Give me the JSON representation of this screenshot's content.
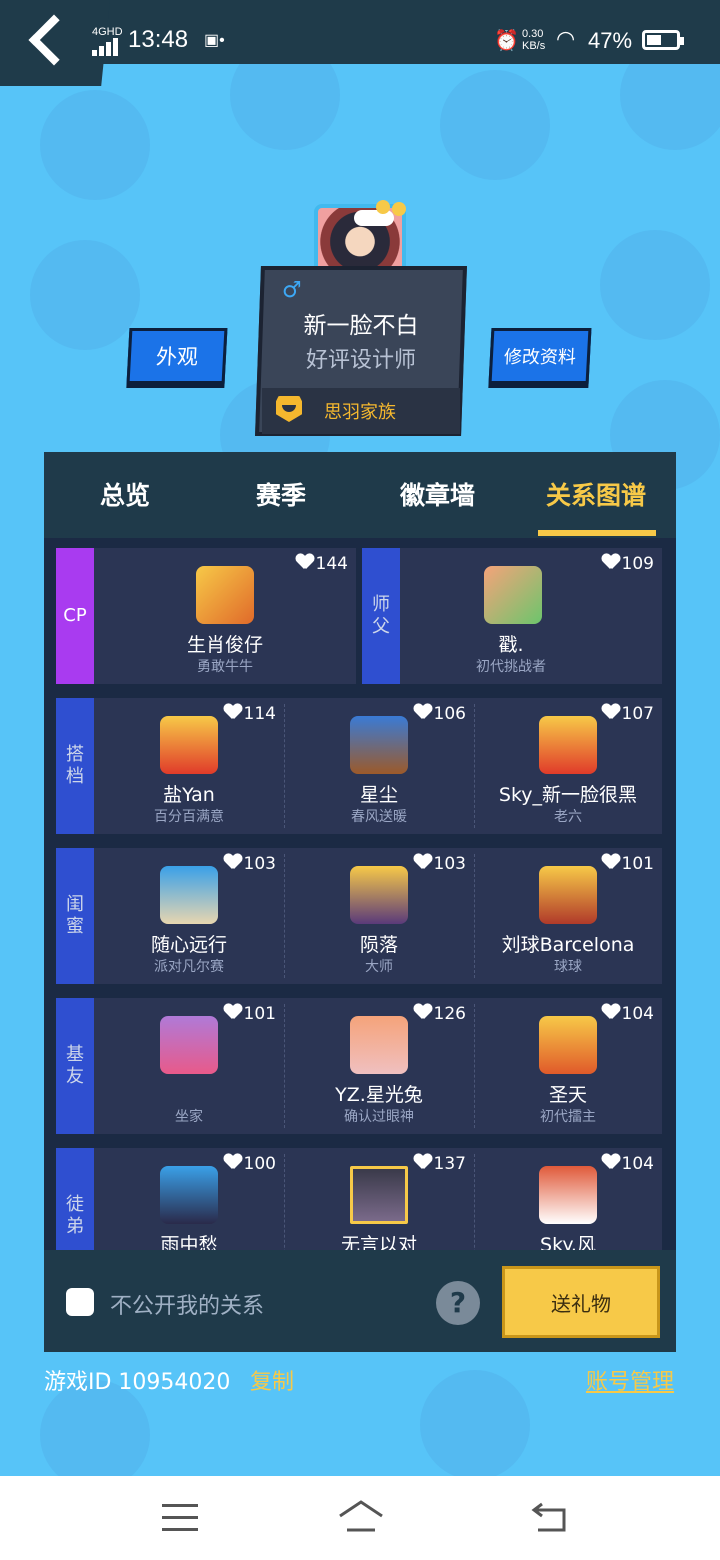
{
  "status_bar": {
    "network": "4GHD",
    "time": "13:48",
    "speed_top": "0.30",
    "speed_bottom": "KB/s",
    "battery": "47%",
    "battery_level": 0.47
  },
  "profile": {
    "nickname": "新一脸不白",
    "title": "好评设计师",
    "family": "思羽家族",
    "gender": "♂"
  },
  "buttons": {
    "appearance": "外观",
    "edit_profile": "修改资料",
    "send_gift": "送礼物"
  },
  "tabs": [
    {
      "label": "总览"
    },
    {
      "label": "赛季"
    },
    {
      "label": "徽章墙"
    },
    {
      "label": "关系图谱"
    }
  ],
  "relations": {
    "cp": {
      "label": "CP",
      "name": "生肖俊仔",
      "sub": "勇敢牛牛",
      "hearts": "144",
      "color": "#a93bf0"
    },
    "master": {
      "label": "师父",
      "name": "戳.",
      "sub": "初代挑战者",
      "hearts": "109",
      "color": "#2f4fd0"
    },
    "rows": [
      {
        "label": "搭档",
        "people": [
          {
            "name": "盐Yan",
            "sub": "百分百满意",
            "hearts": "114"
          },
          {
            "name": "星尘",
            "sub": "春风送暖",
            "hearts": "106"
          },
          {
            "name": "Sky_新一脸很黑",
            "sub": "老六",
            "hearts": "107"
          }
        ]
      },
      {
        "label": "闺蜜",
        "people": [
          {
            "name": "随心远行",
            "sub": "派对凡尔赛",
            "hearts": "103"
          },
          {
            "name": "陨落",
            "sub": "大师",
            "hearts": "103"
          },
          {
            "name": "刘球Barcelona",
            "sub": "球球",
            "hearts": "101"
          }
        ]
      },
      {
        "label": "基友",
        "people": [
          {
            "name": "",
            "sub": "坐家",
            "hearts": "101"
          },
          {
            "name": "YZ.星光兔",
            "sub": "确认过眼神",
            "hearts": "126"
          },
          {
            "name": "圣天",
            "sub": "初代擂主",
            "hearts": "104"
          }
        ]
      },
      {
        "label": "徒弟",
        "people": [
          {
            "name": "雨中愁",
            "sub": "",
            "hearts": "100"
          },
          {
            "name": "无言以对",
            "sub": "",
            "hearts": "137"
          },
          {
            "name": "Sky.风",
            "sub": "",
            "hearts": "104"
          }
        ]
      }
    ]
  },
  "footer": {
    "private_label": "不公开我的关系",
    "help": "?",
    "game_id": "游戏ID 10954020",
    "copy": "复制",
    "account": "账号管理"
  },
  "colors": {
    "background": "#57c4f8",
    "accent": "#f7c948",
    "panel": "#1f3a4a",
    "card": "#2b3554",
    "label_blue": "#2f4fd0"
  }
}
